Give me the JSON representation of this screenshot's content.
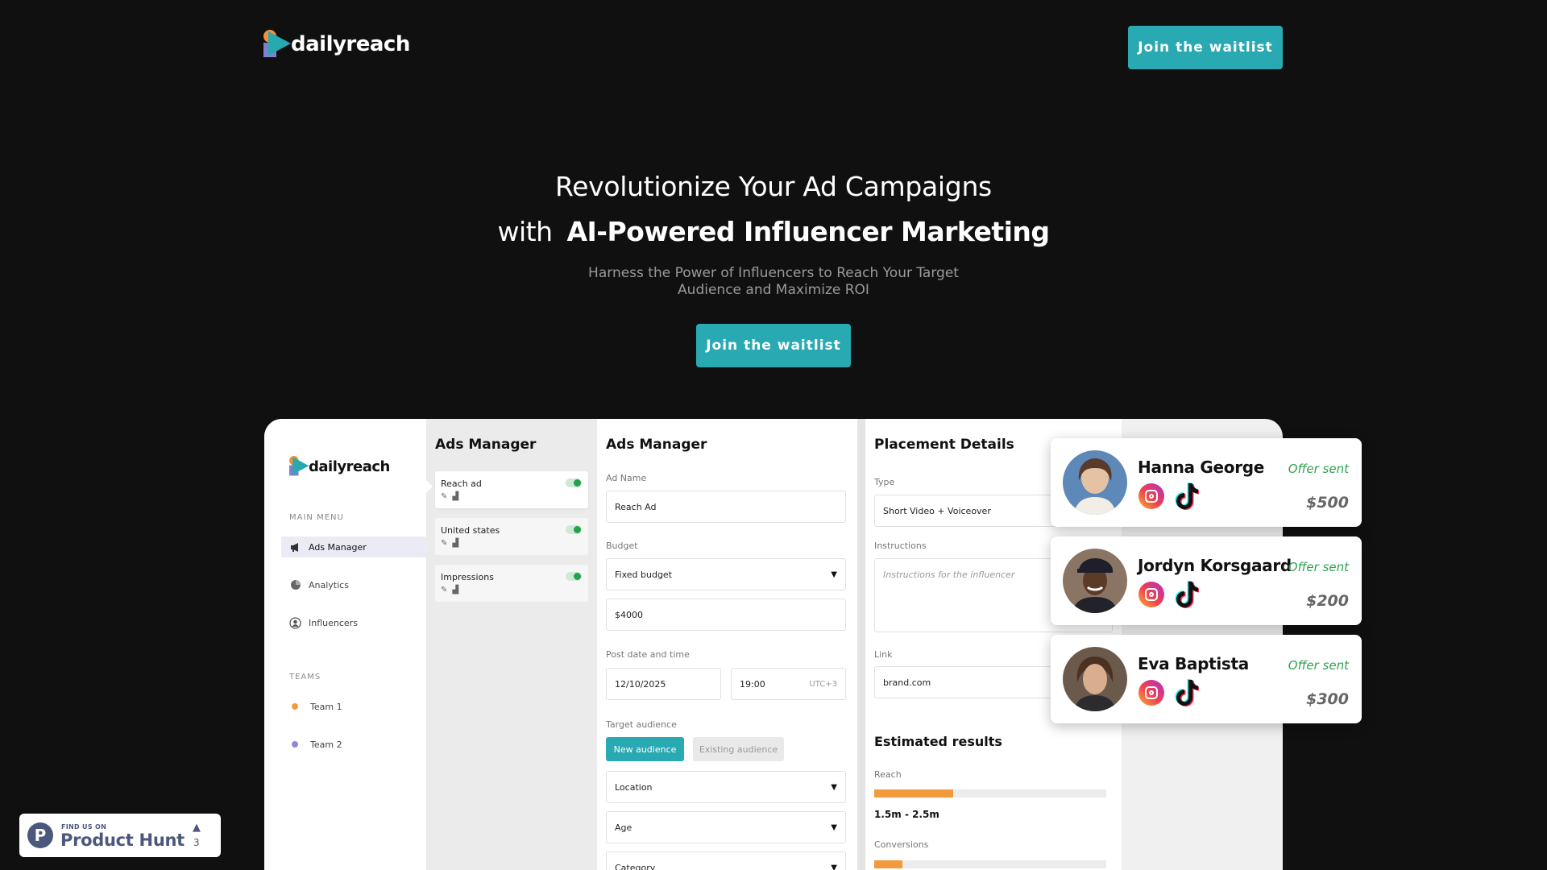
{
  "header": {
    "brand": "dailyreach",
    "cta_label": "Join the waitlist"
  },
  "hero": {
    "line1": "Revolutionize Your Ad Campaigns",
    "line2_prefix": "with",
    "line2_strong": "AI-Powered Influencer Marketing",
    "subtitle": "Harness the Power of Influencers to Reach Your Target Audience and Maximize ROI",
    "cta_label": "Join the waitlist"
  },
  "dashboard": {
    "brand": "dailyreach",
    "sidebar": {
      "main_menu_label": "MAIN MENU",
      "items": [
        {
          "label": "Ads Manager",
          "icon": "megaphone-icon"
        },
        {
          "label": "Analytics",
          "icon": "pie-chart-icon"
        },
        {
          "label": "Influencers",
          "icon": "user-circle-icon"
        }
      ],
      "teams_label": "TEAMS",
      "teams": [
        {
          "label": "Team 1",
          "color": "#f29a3c"
        },
        {
          "label": "Team 2",
          "color": "#8e88d8"
        }
      ]
    },
    "ads_list": {
      "title": "Ads Manager",
      "ads": [
        {
          "name": "Reach ad",
          "enabled": true
        },
        {
          "name": "United states",
          "enabled": true
        },
        {
          "name": "Impressions",
          "enabled": true
        }
      ]
    },
    "form": {
      "title": "Ads Manager",
      "ad_name_label": "Ad Name",
      "ad_name_value": "Reach Ad",
      "budget_label": "Budget",
      "budget_type": "Fixed budget",
      "budget_amount": "$4000",
      "post_label": "Post date and time",
      "post_date": "12/10/2025",
      "post_time": "19:00",
      "timezone": "UTC+3",
      "audience_label": "Target audience",
      "audience_new": "New audience",
      "audience_existing": "Existing audience",
      "location": "Location",
      "age": "Age",
      "category": "Category"
    },
    "placement": {
      "title": "Placement Details",
      "type_label": "Type",
      "type_value": "Short Video + Voiceover",
      "instructions_label": "Instructions",
      "instructions_placeholder": "Instructions for the influencer",
      "link_label": "Link",
      "link_value": "brand.com",
      "results_title": "Estimated results",
      "reach_label": "Reach",
      "reach_fill": 0.34,
      "reach_value": "1.5m - 2.5m",
      "conversions_label": "Conversions",
      "conversions_fill": 0.12
    }
  },
  "influencers": [
    {
      "name": "Hanna George",
      "status": "Offer sent",
      "price": "$500"
    },
    {
      "name": "Jordyn Korsgaard",
      "status": "Offer sent",
      "price": "$200"
    },
    {
      "name": "Eva Baptista",
      "status": "Offer sent",
      "price": "$300"
    }
  ],
  "product_hunt": {
    "small": "FIND US ON",
    "big": "Product Hunt",
    "votes": "3"
  },
  "colors": {
    "background": "#101010",
    "accent": "#29a9b1",
    "orange": "#f29a3c",
    "status_green": "#2ca24e"
  }
}
